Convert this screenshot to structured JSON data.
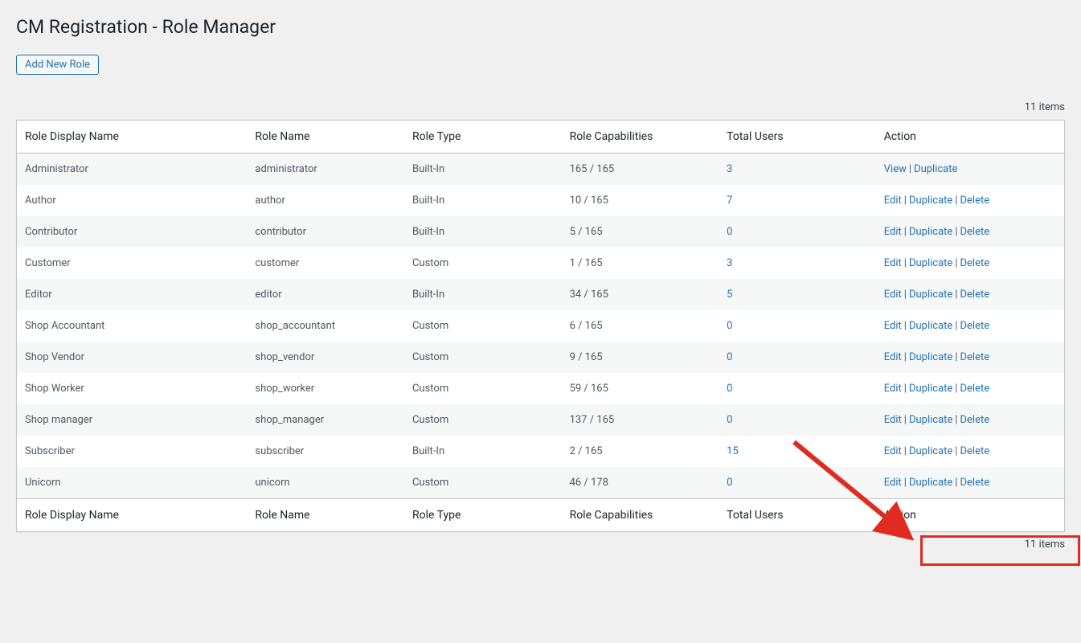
{
  "page": {
    "title": "CM Registration - Role Manager",
    "add_new_label": "Add New Role",
    "items_count": "11 items"
  },
  "table": {
    "headers": {
      "display_name": "Role Display Name",
      "name": "Role Name",
      "type": "Role Type",
      "capabilities": "Role Capabilities",
      "users": "Total Users",
      "action": "Action"
    },
    "actions": {
      "view": "View",
      "edit": "Edit",
      "duplicate": "Duplicate",
      "delete": "Delete"
    },
    "rows": [
      {
        "display": "Administrator",
        "name": "administrator",
        "type": "Built-In",
        "caps": "165 / 165",
        "users": "3",
        "actions": [
          "view",
          "duplicate"
        ]
      },
      {
        "display": "Author",
        "name": "author",
        "type": "Built-In",
        "caps": "10 / 165",
        "users": "7",
        "actions": [
          "edit",
          "duplicate",
          "delete"
        ]
      },
      {
        "display": "Contributor",
        "name": "contributor",
        "type": "Built-In",
        "caps": "5 / 165",
        "users": "0",
        "actions": [
          "edit",
          "duplicate",
          "delete"
        ]
      },
      {
        "display": "Customer",
        "name": "customer",
        "type": "Custom",
        "caps": "1 / 165",
        "users": "3",
        "actions": [
          "edit",
          "duplicate",
          "delete"
        ]
      },
      {
        "display": "Editor",
        "name": "editor",
        "type": "Built-In",
        "caps": "34 / 165",
        "users": "5",
        "actions": [
          "edit",
          "duplicate",
          "delete"
        ]
      },
      {
        "display": "Shop Accountant",
        "name": "shop_accountant",
        "type": "Custom",
        "caps": "6 / 165",
        "users": "0",
        "actions": [
          "edit",
          "duplicate",
          "delete"
        ]
      },
      {
        "display": "Shop Vendor",
        "name": "shop_vendor",
        "type": "Custom",
        "caps": "9 / 165",
        "users": "0",
        "actions": [
          "edit",
          "duplicate",
          "delete"
        ]
      },
      {
        "display": "Shop Worker",
        "name": "shop_worker",
        "type": "Custom",
        "caps": "59 / 165",
        "users": "0",
        "actions": [
          "edit",
          "duplicate",
          "delete"
        ]
      },
      {
        "display": "Shop manager",
        "name": "shop_manager",
        "type": "Custom",
        "caps": "137 / 165",
        "users": "0",
        "actions": [
          "edit",
          "duplicate",
          "delete"
        ]
      },
      {
        "display": "Subscriber",
        "name": "subscriber",
        "type": "Built-In",
        "caps": "2 / 165",
        "users": "15",
        "actions": [
          "edit",
          "duplicate",
          "delete"
        ]
      },
      {
        "display": "Unicorn",
        "name": "unicorn",
        "type": "Custom",
        "caps": "46 / 178",
        "users": "0",
        "actions": [
          "edit",
          "duplicate",
          "delete"
        ]
      }
    ]
  }
}
